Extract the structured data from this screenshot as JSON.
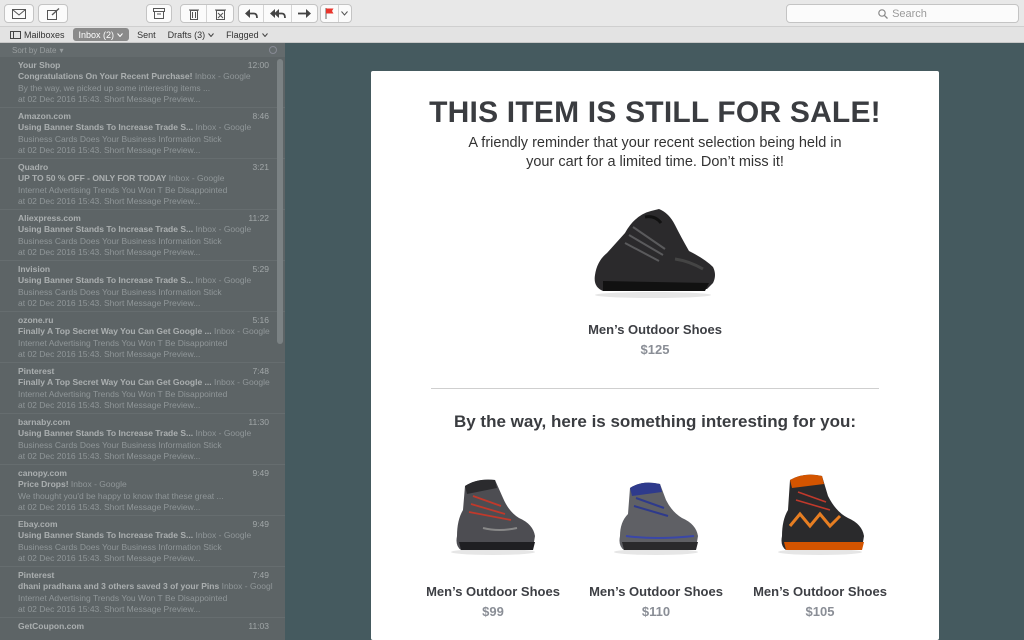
{
  "toolbar": {
    "buttons": [
      "get-mail",
      "compose",
      "archive",
      "delete",
      "junk",
      "reply",
      "reply-all",
      "forward",
      "flag"
    ],
    "search_placeholder": "Search"
  },
  "favorites": {
    "mailboxes": "Mailboxes",
    "inbox": "Inbox (2)",
    "sent": "Sent",
    "drafts": "Drafts (3)",
    "flagged": "Flagged"
  },
  "list": {
    "sort_label": "Sort by Date",
    "messages": [
      {
        "sender": "Your Shop",
        "time": "12:00",
        "subject": "Congratulations On Your Recent Purchase!",
        "tag": "Inbox - Google",
        "line1": "By the way, we picked up some interesting items ...",
        "line2": "at 02 Dec 2016 15:43. Short Message Preview..."
      },
      {
        "sender": "Amazon.com",
        "time": "8:46",
        "subject": "Using Banner Stands To Increase Trade S...",
        "tag": "Inbox - Google",
        "line1": "Business Cards Does Your Business Information Stick",
        "line2": "at 02 Dec 2016 15:43. Short Message Preview..."
      },
      {
        "sender": "Quadro",
        "time": "3:21",
        "subject": "UP TO 50 % OFF - ONLY FOR TODAY",
        "tag": "Inbox - Google",
        "line1": "Internet Advertising Trends You Won T Be Disappointed",
        "line2": "at 02 Dec 2016 15:43. Short Message Preview..."
      },
      {
        "sender": "Aliexpress.com",
        "time": "11:22",
        "subject": "Using Banner Stands To Increase Trade S...",
        "tag": "Inbox - Google",
        "line1": "Business Cards Does Your Business Information Stick",
        "line2": "at 02 Dec 2016 15:43. Short Message Preview..."
      },
      {
        "sender": "Invision",
        "time": "5:29",
        "subject": "Using Banner Stands To Increase Trade S...",
        "tag": "Inbox - Google",
        "line1": "Business Cards Does Your Business Information Stick",
        "line2": "at 02 Dec 2016 15:43. Short Message Preview..."
      },
      {
        "sender": "ozone.ru",
        "time": "5:16",
        "subject": "Finally A Top Secret Way You Can Get Google ...",
        "tag": "Inbox - Google",
        "line1": "Internet Advertising Trends You Won T Be Disappointed",
        "line2": "at 02 Dec 2016 15:43. Short Message Preview..."
      },
      {
        "sender": "Pinterest",
        "time": "7:48",
        "subject": "Finally A Top Secret Way You Can Get Google ...",
        "tag": "Inbox - Google",
        "line1": "Internet Advertising Trends You Won T Be Disappointed",
        "line2": "at 02 Dec 2016 15:43. Short Message Preview..."
      },
      {
        "sender": "barnaby.com",
        "time": "11:30",
        "subject": "Using Banner Stands To Increase Trade S...",
        "tag": "Inbox - Google",
        "line1": "Business Cards Does Your Business Information Stick",
        "line2": "at 02 Dec 2016 15:43. Short Message Preview..."
      },
      {
        "sender": "canopy.com",
        "time": "9:49",
        "subject": "Price Drops!",
        "tag": "Inbox - Google",
        "line1": "We thought you'd be happy to know that these great ...",
        "line2": "at 02 Dec 2016 15:43. Short Message Preview..."
      },
      {
        "sender": "Ebay.com",
        "time": "9:49",
        "subject": "Using Banner Stands To Increase Trade S...",
        "tag": "Inbox - Google",
        "line1": "Business Cards Does Your Business Information Stick",
        "line2": "at 02 Dec 2016 15:43. Short Message Preview..."
      },
      {
        "sender": "Pinterest",
        "time": "7:49",
        "subject": "dhani pradhana and 3 others saved 3 of your Pins",
        "tag": "Inbox - Google",
        "line1": "Internet Advertising Trends You Won T Be Disappointed",
        "line2": "at 02 Dec 2016 15:43. Short Message Preview..."
      },
      {
        "sender": "GetCoupon.com",
        "time": "11:03",
        "subject": "",
        "tag": "",
        "line1": "",
        "line2": ""
      }
    ]
  },
  "email": {
    "headline": "THIS ITEM IS STILL FOR SALE!",
    "subline1": "A friendly reminder that your recent selection being held in",
    "subline2": "your cart for a limited time. Don’t miss it!",
    "hero": {
      "name": "Men’s Outdoor Shoes",
      "price": "$125"
    },
    "by_the_way": "By the way, here is something interesting for you:",
    "recommendations": [
      {
        "name": "Men’s Outdoor Shoes",
        "price": "$99"
      },
      {
        "name": "Men’s Outdoor Shoes",
        "price": "$110"
      },
      {
        "name": "Men’s Outdoor Shoes",
        "price": "$105"
      }
    ]
  },
  "colors": {
    "background": "#455a5f",
    "card": "#ffffff",
    "heading": "#3a3c40",
    "price": "#8a8e96",
    "flag": "#e8352c"
  }
}
